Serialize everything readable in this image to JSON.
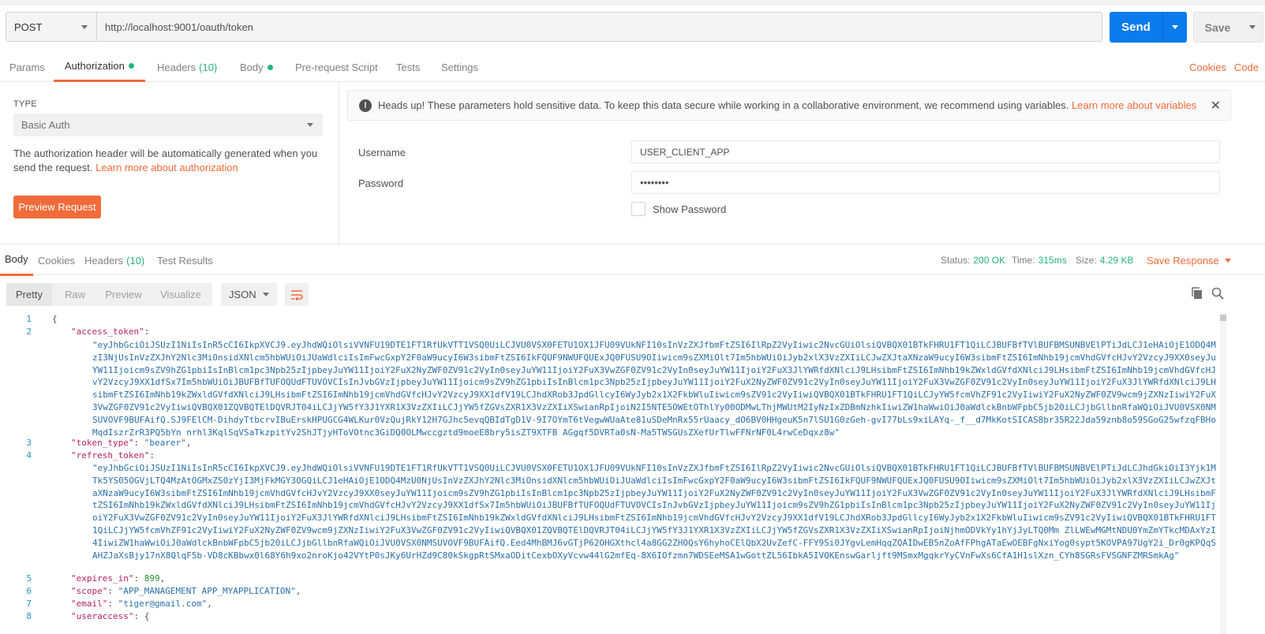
{
  "request": {
    "method": "POST",
    "url": "http://localhost:9001/oauth/token",
    "send_label": "Send",
    "save_label": "Save"
  },
  "req_tabs": [
    {
      "label": "Params"
    },
    {
      "label": "Authorization"
    },
    {
      "label": "Headers",
      "count": "(10)"
    },
    {
      "label": "Body"
    },
    {
      "label": "Pre-request Script"
    },
    {
      "label": "Tests"
    },
    {
      "label": "Settings"
    }
  ],
  "right_links": {
    "cookies": "Cookies",
    "code": "Code"
  },
  "auth": {
    "type_label": "TYPE",
    "type_value": "Basic Auth",
    "desc": "The authorization header will be automatically generated when you send the request.",
    "desc_link": "Learn more about authorization",
    "preview_button": "Preview Request",
    "notice": "Heads up! These parameters hold sensitive data. To keep this data secure while working in a collaborative environment, we recommend using variables.",
    "notice_link": "Learn more about variables",
    "username_label": "Username",
    "username_value": "USER_CLIENT_APP",
    "password_label": "Password",
    "password_value": "••••••••",
    "show_password": "Show Password"
  },
  "resp_tabs": [
    {
      "label": "Body"
    },
    {
      "label": "Cookies"
    },
    {
      "label": "Headers",
      "count": "(10)"
    },
    {
      "label": "Test Results"
    }
  ],
  "status": {
    "status_label": "Status:",
    "status_value": "200 OK",
    "time_label": "Time:",
    "time_value": "315ms",
    "size_label": "Size:",
    "size_value": "4.29 KB",
    "save_response": "Save Response"
  },
  "format": {
    "buttons": [
      "Pretty",
      "Raw",
      "Preview",
      "Visualize"
    ],
    "lang": "JSON"
  },
  "colors": {
    "accent": "#f26b3a",
    "primary": "#097bed",
    "success": "#26b47f"
  },
  "code": {
    "line_numbers": [
      "1",
      "2",
      "3",
      "4",
      "5",
      "6",
      "7",
      "8"
    ],
    "open_brace": "{",
    "access_token_key": "\"access_token\"",
    "access_token_value": "\"eyJhbGciOiJSUzI1NiIsInR5cCI6IkpXVCJ9.eyJhdWQiOlsiVVNFU19DTE1FT1RfUkVTT1VSQ0UiLCJVU0VSX0FETU1OX1JFU09VUkNFI10sInVzZXJfbmFtZSI6IlRpZ2VyIiwic2NvcGUiOlsiQVBQX01BTkFHRU1FT1QiLCJBUFBfTVlBUFBMSUNBVElPTiJdLCJ1eHAiOjE1ODQ4MzI3NjUsInVzZXJhY2Nlc3MiOnsidXNlcm5hbWUiOiJUaWdlciIsImFwcGxpY2F0aW9ucyI6W3sibmFtZSI6IkFQUF9NWUFQUExJQ0FUSU9OIiwicm9sZXMiOlt7Im5hbWUiOiJyb2xlX3VzZXIiLCJwZXJtaXNzaW9ucyI6W3sibmFtZSI6ImNhb19jcmVhdGVfcHJvY2VzcyJ9XX0seyJuYW11Ijoicm9sZV9hZG1pbiIsInBlcm1pc3Npb25zIjpbeyJuYW11IjoiY2FuX2NyZWF0ZV91c2VyIn0seyJuYW11IjoiY2FuX3VwZGF0ZV91c2VyIn0seyJuYW11IjoiY2FuX3JlYWRfdXNlciJ9LHsibmFtZSI6ImNhb19kZWxldGVfdXNlciJ9LHsibmFtZSI6ImNhb19jcmVhdGVfcHJvY2VzcyJ9XX1dfSx7Im5hbWUiOiJBUFBfTUFOQUdFTUVOVCIsInJvbGVzIjpbeyJuYW11Ijoicm9sZV9hZG1pbiIsInBlcm1pc3Npb25zIjpbeyJuYW11IjoiY2FuX2NyZWF0ZV91c2VyIn0seyJuYW11IjoiY2FuX3VwZGF0ZV91c2VyIn0seyJuYW11IjoiY2FuX3JlYWRfdXNlciJ9LHsibmFtZSI6ImNhb19kZWxldGVfdXNlciJ9LHsibmFtZSI6ImNhb19jcmVhdGVfcHJvY2VzcyJ9XX1dfV19LCJhdXRob3JpdGllcyI6WyJyb2x1X2FkbWluIiwicm9sZV91c2VyIiwiQVBQX01BTkFHRU1FT1QiLCJyYW5fcmVhZF91c2VyIiwiY2FuX2NyZWF0ZV9wcm9jZXNzIiwiY2FuX3VwZGF0ZV91c2VyIiwiQVBQX01ZQVBQTElDQVRJT04iLCJjYW5fY3J1YXR1X3VzZXIiLCJjYW5fZGVsZXR1X3VzZXIiXSwianRpIjoiN2I5NTE5OWEtOThlYy00ODMwLThjMWUtM2IyNzIxZDBmNzhkIiwiZW1haWwiOiJ0aWdlckBnbWFpbC5jb20iLCJjbGllbnRfaWQiOiJVU0VSX0NMSUVOVF9BUFAifQ.SJ9FElCM-DihdyTtbcrvIBuErskHPUGCG4WLKur0VzQujRkY12H7GJhc5evqQBIdTgD1V-9I7OYmT6tVegwWUaAte81uSDeMnRx55rUaacy_dO6BV0HHgeuK5n7lSU1G0zGeh-gvI77bLs9xiLAYq-_f__d7MkKotSICAS8br35R22Jda59znb8o59SGoG25wfzqFBHoMqdIszrZrR3PQ5bYn_nrhl3KqlSqVSaTkzpitYv2ShJTjyHToVOtnc3GiDQ0OLMwccgztd9moeE8bry5isZT9XTFB_AGgqf5DVRTa0sN-Ma5TWSGUsZXefUrTlwFFNrNF0L4rwCeDqxz8w\"",
    "token_type_key": "\"token_type\"",
    "token_type_value": "\"bearer\"",
    "refresh_token_key": "\"refresh_token\"",
    "refresh_token_value": "\"eyJhbGciOiJSUzI1NiIsInR5cCI6IkpXVCJ9.eyJhdWQiOlsiVVNFU19DTE1FT1RfUkVTT1VSQ0UiLCJVU0VSX0FETU1OX1JFU09VUkNFI10sInVzZXJfbmFtZSI6IlRpZ2VyIiwic2NvcGUiOlsiQVBQX01BTkFHRU1FT1QiLCJBUFBfTVlBUFBMSUNBVElPTiJdLCJhdGkiOiI3Yjk1MTk5YS05OGVjLTQ4MzAtOGMxZS0zYjI3MjFkMGY3OGQiLCJ1eHAiOjE1ODQ4MzU0NjUsInVzZXJhY2Nlc3MiOnsidXNlcm5hbWUiOiJUaWdlciIsImFwcGxpY2F0aW9ucyI6W3sibmFtZSI6IkFQUF9NWUFQUExJQ0FUSU9OIiwicm9sZXMiOlt7Im5hbWUiOiJyb2xlX3VzZXIiLCJwZXJtaXNzaW9ucyI6W3sibmFtZSI6ImNhb19jcmVhdGVfcHJvY2VzcyJ9XX0seyJuYW11Ijoicm9sZV9hZG1pbiIsInBlcm1pc3Npb25zIjpbeyJuYW11IjoiY2FuX2NyZWF0ZV91c2VyIn0seyJuYW11IjoiY2FuX3VwZGF0ZV91c2VyIn0seyJuYW11IjoiY2FuX3JlYWRfdXNlciJ9LHsibmFtZSI6ImNhb19kZWxldGVfdXNlciJ9LHsibmFtZSI6ImNhb19jcmVhdGVfcHJvY2VzcyJ9XX1dfSx7Im5hbWUiOiJBUFBfTUFOQUdFTUVOVCIsInJvbGVzIjpbeyJuYW11Ijoicm9sZV9hZG1pbiIsInBlcm1pc3Npb25zIjpbeyJuYW11IjoiY2FuX2NyZWF0ZV91c2VyIn0seyJuYW11IjoiY2FuX3VwZGF0ZV91c2VyIn0seyJuYW11IjoiY2FuX3JlYWRfdXNlciJ9LHsibmFtZSI6ImNhb19kZWxldGVfdXNlciJ9LHsibmFtZSI6ImNhb19jcmVhdGVfcHJvY2VzcyJ9XX1dfV19LCJhdXRob3JpdGllcyI6WyJyb2x1X2FkbWluIiwicm9sZV91c2VyIiwiQVBQX01BTkFHRU1FT1QiLCJjYW5fcmVhZF91c2VyIiwiY2FuX2NyZWF0ZV9wcm9jZXNzIiwiY2FuX3VwZGF0ZV91c2VyIiwiQVBQX01ZQVBQTElDQVRJT04iLCJjYW5fY3J1YXR1X3VzZXIiLCJjYW5fZGVsZXR1X3VzZXIiXSwianRpIjoiNjhmODVkYy1hYjJyLTQ0Mm ZlLWEwMGMtNDU0YmZmYTkcMDAxYzI4IiwiZW1haWwiOiJ0aWdlckBnbWFpbC5jb20iLCJjbGllbnRfaWQiOiJVU0VSX0NMSUVOVF9BUFAifQ.Eed4MhBMJ6vGTjP62OHGXthcl4a8GG2ZHOQsY6hyhoCElQbX2UvZefC-FFY9Si0JYgvLemHqqZQAIDwEB5nZoAfFPhgATaEwOEBFgNxiYog0sypt5KOVPA97UgY2i_Dr0gKPQqSAHZJaXsBjy17nX8QlqF5b-VD8cKBbwx0l68Y6h9xo2nroKjo42VYtP0sJKy6UrHZd9C80kSkgpRtSMxaODitCexbOXyVcvw44lG2mfEq-8X6IOfzmn7WDSEeMSA1wGottZL56IbkA5IVQKEnswGarljft9MSmxMgqkrYyCVnFwXs6CfA1H1slXzn_CYh8SGRsFVSGNFZMRSmkAg\"",
    "expires_key": "\"expires_in\"",
    "expires_value": "899",
    "scope_key": "\"scope\"",
    "scope_value": "\"APP_MANAGEMENT APP_MYAPPLICATION\"",
    "email_key": "\"email\"",
    "email_value": "\"tiger@gmail.com\"",
    "useraccess_key": "\"useraccess\""
  }
}
